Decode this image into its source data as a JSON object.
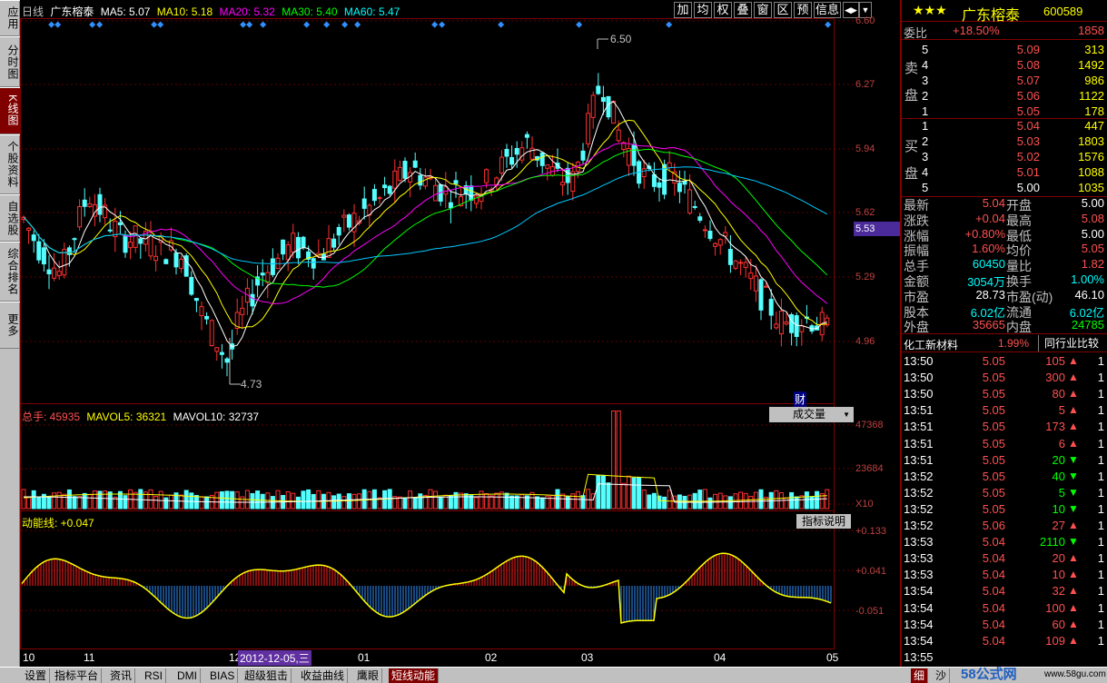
{
  "left_tabs": [
    {
      "label": "应用"
    },
    {
      "label": "分时图"
    },
    {
      "label": "K线图",
      "active": true
    },
    {
      "label": "个股资料"
    },
    {
      "label": "自选股"
    },
    {
      "label": "综合排名"
    },
    {
      "label": "更多"
    }
  ],
  "chart": {
    "header": {
      "period": "日线",
      "name": "广东榕泰",
      "ma5": "MA5: 5.07",
      "ma10": "MA10: 5.18",
      "ma20": "MA20: 5.32",
      "ma30": "MA30: 5.40",
      "ma60": "MA60: 5.47"
    },
    "toolbar": [
      "加",
      "均",
      "权",
      "叠",
      "窗",
      "区",
      "预",
      "信息",
      "◀▶",
      "▼"
    ],
    "price_ticks": [
      "6.60",
      "6.27",
      "5.94",
      "5.62",
      "5.53",
      "5.29",
      "4.96"
    ],
    "high_label": "6.50",
    "low_label": "4.73",
    "cai_label": "财",
    "volume": {
      "label": "总手: 45935",
      "mavol5": "MAVOL5: 36321",
      "mavol10": "MAVOL10: 32737",
      "select": "成交量",
      "ticks": [
        "47368",
        "23684",
        "X10"
      ]
    },
    "indicator": {
      "label": "动能线: +0.047",
      "help": "指标说明",
      "ticks": [
        "+0.133",
        "+0.041",
        "-0.051"
      ]
    },
    "x_labels": [
      "10",
      "11",
      "12",
      "01",
      "02",
      "03",
      "04",
      "05"
    ],
    "date_cursor": "2012-12-05,三"
  },
  "quote": {
    "stars": "★★★",
    "name": "广东榕泰",
    "code": "600589",
    "weibi_label": "委比",
    "weibi": "+18.50%",
    "weicha": "1858",
    "sell_label": "卖盘",
    "buy_label": "买盘",
    "sell": [
      {
        "n": "5",
        "p": "5.09",
        "v": "313"
      },
      {
        "n": "4",
        "p": "5.08",
        "v": "1492"
      },
      {
        "n": "3",
        "p": "5.07",
        "v": "986"
      },
      {
        "n": "2",
        "p": "5.06",
        "v": "1122"
      },
      {
        "n": "1",
        "p": "5.05",
        "v": "178"
      }
    ],
    "buy": [
      {
        "n": "1",
        "p": "5.04",
        "v": "447"
      },
      {
        "n": "2",
        "p": "5.03",
        "v": "1803"
      },
      {
        "n": "3",
        "p": "5.02",
        "v": "1576"
      },
      {
        "n": "4",
        "p": "5.01",
        "v": "1088"
      },
      {
        "n": "5",
        "p": "5.00",
        "v": "1035"
      }
    ],
    "stats": [
      [
        "最新",
        "5.04",
        "开盘",
        "5.00"
      ],
      [
        "涨跌",
        "+0.04",
        "最高",
        "5.08"
      ],
      [
        "涨幅",
        "+0.80%",
        "最低",
        "5.00"
      ],
      [
        "振幅",
        "1.60%",
        "均价",
        "5.05"
      ],
      [
        "总手",
        "60450",
        "量比",
        "1.82"
      ],
      [
        "金额",
        "3054万",
        "换手",
        "1.00%"
      ],
      [
        "市盈",
        "28.73",
        "市盈(动)",
        "46.10"
      ],
      [
        "股本",
        "6.02亿",
        "流通",
        "6.02亿"
      ],
      [
        "外盘",
        "35665",
        "内盘",
        "24785"
      ]
    ],
    "industry": "化工新材料",
    "industry_pct": "1.99%",
    "industry_btn": "同行业比较",
    "ticks": [
      [
        "13:50",
        "5.05",
        "105",
        "up"
      ],
      [
        "13:50",
        "5.05",
        "300",
        "up"
      ],
      [
        "13:50",
        "5.05",
        "80",
        "up"
      ],
      [
        "13:51",
        "5.05",
        "5",
        "up"
      ],
      [
        "13:51",
        "5.05",
        "173",
        "up"
      ],
      [
        "13:51",
        "5.05",
        "6",
        "up"
      ],
      [
        "13:51",
        "5.05",
        "20",
        "down"
      ],
      [
        "13:52",
        "5.05",
        "40",
        "down"
      ],
      [
        "13:52",
        "5.05",
        "5",
        "down"
      ],
      [
        "13:52",
        "5.05",
        "10",
        "down"
      ],
      [
        "13:52",
        "5.06",
        "27",
        "up"
      ],
      [
        "13:53",
        "5.04",
        "2110",
        "down"
      ],
      [
        "13:53",
        "5.04",
        "20",
        "up"
      ],
      [
        "13:53",
        "5.04",
        "10",
        "up"
      ],
      [
        "13:54",
        "5.04",
        "32",
        "up"
      ],
      [
        "13:54",
        "5.04",
        "100",
        "up"
      ],
      [
        "13:54",
        "5.04",
        "60",
        "up"
      ],
      [
        "13:54",
        "5.04",
        "109",
        "up"
      ],
      [
        "13:55",
        "",
        "",
        " "
      ]
    ],
    "bottom_tabs": [
      "细",
      "沙"
    ]
  },
  "bottom_tabs": [
    "设置",
    "指标平台",
    "资讯",
    "RSI",
    "DMI",
    "BIAS",
    "超级狙击",
    "收益曲线",
    "鹰眼",
    "短线动能"
  ],
  "watermark": "58公式网",
  "watermark_url": "www.58gu.com"
}
